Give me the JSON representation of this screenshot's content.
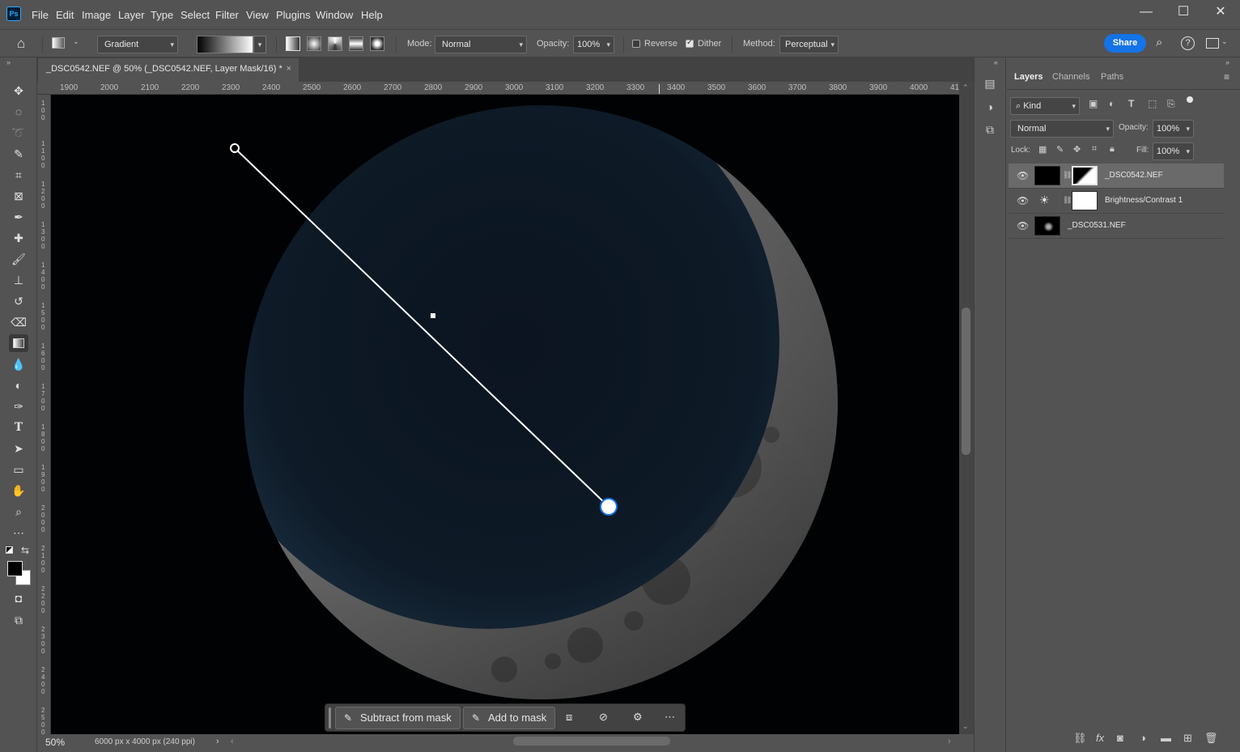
{
  "app": {
    "logo": "Ps"
  },
  "menu": [
    "File",
    "Edit",
    "Image",
    "Layer",
    "Type",
    "Select",
    "Filter",
    "View",
    "Plugins",
    "Window",
    "Help"
  ],
  "options": {
    "preset": "Gradient",
    "mode_label": "Mode:",
    "mode_value": "Normal",
    "opacity_label": "Opacity:",
    "opacity_value": "100%",
    "reverse_label": "Reverse",
    "reverse_checked": false,
    "dither_label": "Dither",
    "dither_checked": true,
    "method_label": "Method:",
    "method_value": "Perceptual",
    "share_label": "Share"
  },
  "document": {
    "tab_title": "_DSC0542.NEF @ 50% (_DSC0542.NEF, Layer Mask/16) *",
    "zoom": "50%",
    "info": "6000 px x 4000 px (240 ppi)"
  },
  "ruler_top": [
    "1900",
    "2000",
    "2100",
    "2200",
    "2300",
    "2400",
    "2500",
    "2600",
    "2700",
    "2800",
    "2900",
    "3000",
    "3100",
    "3200",
    "3300",
    "3400",
    "3500",
    "3600",
    "3700",
    "3800",
    "3900",
    "4000",
    "41"
  ],
  "ruler_left": [
    "1 0 0",
    "1 1 0 0",
    "1 2 0 0",
    "1 3 0 0",
    "1 4 0 0",
    "1 5 0 0",
    "1 6 0 0",
    "1 7 0 0",
    "1 8 0 0",
    "1 9 0 0",
    "2 0 0 0",
    "2 1 0 0",
    "2 2 0 0",
    "2 3 0 0",
    "2 4 0 0",
    "2 5 0 0"
  ],
  "taskbar": {
    "subtract_label": "Subtract from mask",
    "add_label": "Add to mask"
  },
  "layers_panel": {
    "tabs": [
      "Layers",
      "Channels",
      "Paths"
    ],
    "filter_kind": "Kind",
    "blend_mode": "Normal",
    "opacity_label": "Opacity:",
    "opacity_value": "100%",
    "lock_label": "Lock:",
    "fill_label": "Fill:",
    "fill_value": "100%",
    "layers": [
      {
        "name": "_DSC0542.NEF",
        "selected": true
      },
      {
        "name": "Brightness/Contrast 1",
        "selected": false
      },
      {
        "name": "_DSC0531.NEF",
        "selected": false
      }
    ]
  },
  "colors": {
    "accent": "#1473e6",
    "ui_gray": "#535353",
    "canvas_bg": "#010203"
  }
}
